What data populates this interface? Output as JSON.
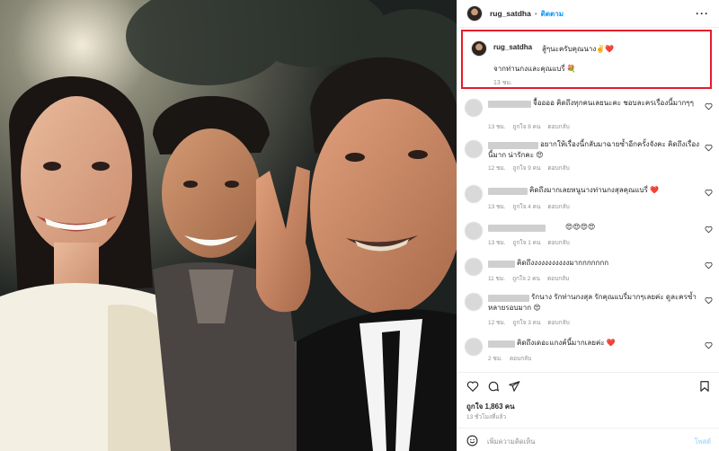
{
  "post": {
    "username": "rug_satdha",
    "dot": "•",
    "follow_label": "ติดตาม",
    "more_label": "···"
  },
  "caption": {
    "username": "rug_satdha",
    "text_line1": "สู้ๆนะครับคุณนาง✌️❤️",
    "text_line2": "จากท่านกงและคุณแบรี่ 💐",
    "time": "13 ชม."
  },
  "comments": [
    {
      "text": "จื้ออออ คิดถึงทุกคนเลยนะคะ ชอบละครเรื่องนี้มากๆๆ",
      "time": "13 ชม.",
      "likes": "ถูกใจ 8 คน",
      "reply": "ตอบกลับ"
    },
    {
      "text": "อยากให้เรื่องนี้กลับมาฉายซ้ำอีกครั้งจังคะ คิดถึงเรื่องนี้มาก น่ารักคะ 😍",
      "time": "12 ชม.",
      "likes": "ถูกใจ 9 คน",
      "reply": "ตอบกลับ"
    },
    {
      "text": "คิดถึงมากเลยหนูนางท่านกงสุลคุณแบรี่ ❤️",
      "time": "13 ชม.",
      "likes": "ถูกใจ 4 คน",
      "reply": "ตอบกลับ"
    },
    {
      "text": "😍😍😍😍",
      "time": "13 ชม.",
      "likes": "ถูกใจ 1 คน",
      "reply": "ตอบกลับ"
    },
    {
      "text": "คิดถึงงงงงงงงงงงมากกกกกกก",
      "time": "11 ชม.",
      "likes": "ถูกใจ 2 คน",
      "reply": "ตอบกลับ"
    },
    {
      "text": "รักนาง รักท่านกงสุล รักคุณแบรี่มากๆเลยค่ะ ดูละครซ้ำหลายรอบมาก 😍",
      "time": "12 ชม.",
      "likes": "ถูกใจ 3 คน",
      "reply": "ตอบกลับ"
    },
    {
      "text": "คิดถึงเดอะแกงค์นี้มากเลยค่ะ ❤️",
      "time": "2 ชม.",
      "likes": "",
      "reply": "ตอบกลับ"
    }
  ],
  "likes_count": "ถูกใจ 1,863 คน",
  "posted_time": "13 ชั่วโมงที่แล้ว",
  "add_comment": {
    "placeholder": "เพิ่มความคิดเห็น",
    "post_label": "โพสต์"
  },
  "colors": {
    "highlight_border": "#e8192c",
    "link_blue": "#0095f6",
    "heart_red": "#ed4956"
  },
  "icons": [
    "more-icon",
    "heart-icon",
    "comment-icon",
    "share-icon",
    "bookmark-icon",
    "smile-icon"
  ]
}
